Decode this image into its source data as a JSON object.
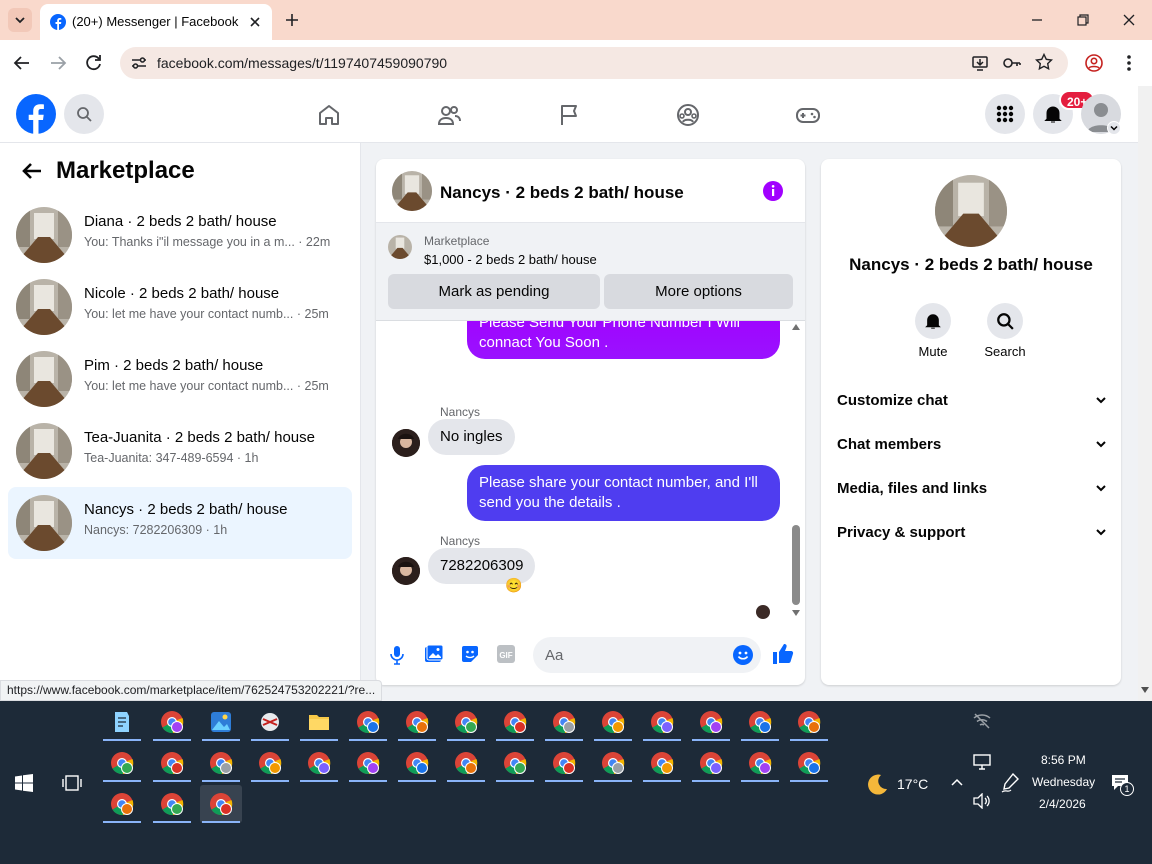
{
  "browser": {
    "tab_title": "(20+) Messenger | Facebook",
    "url": "facebook.com/messages/t/1197407459090790",
    "status_url": "https://www.facebook.com/marketplace/item/762524753202221/?re..."
  },
  "fb": {
    "notification_badge": "20+",
    "nav_icons": [
      "home-icon",
      "friends-icon",
      "pages-flag-icon",
      "groups-icon",
      "gaming-icon"
    ]
  },
  "sidebar": {
    "title": "Marketplace",
    "conversations": [
      {
        "name": "Diana · 2 beds 2 bath/ house",
        "preview": "You: Thanks i\"il message you in a m...",
        "time": "· 22m"
      },
      {
        "name": "Nicole · 2 beds 2 bath/ house",
        "preview": "You: let me have your contact numb...",
        "time": "· 25m"
      },
      {
        "name": "Pim · 2 beds 2 bath/ house",
        "preview": "You: let me have your contact numb...",
        "time": "· 25m"
      },
      {
        "name": "Tea-Juanita · 2 beds 2 bath/ house",
        "preview": "Tea-Juanita: 347-489-6594",
        "time": "· 1h"
      },
      {
        "name": "Nancys · 2 beds 2 bath/ house",
        "preview": "Nancys: 7282206309",
        "time": "· 1h"
      }
    ]
  },
  "chat": {
    "header_name": "Nancys · 2 beds 2 bath/ house",
    "marketplace_label": "Marketplace",
    "listing": "$1,000 - 2 beds 2 bath/ house",
    "mark_pending": "Mark as pending",
    "more_options": "More options",
    "messages": [
      {
        "from": "me",
        "text": "Please Send Your Phone Number I Will connact You Soon ."
      },
      {
        "from": "Nancys",
        "sender": "Nancys",
        "text": "No ingles"
      },
      {
        "from": "me",
        "text": "Please share your contact number, and I'll send you the details ."
      },
      {
        "from": "Nancys",
        "sender": "Nancys",
        "text": "7282206309",
        "reaction": "😊"
      }
    ],
    "composer_placeholder": "Aa"
  },
  "info_panel": {
    "name": "Nancys · 2 beds 2 bath/ house",
    "actions": [
      {
        "label": "Mute"
      },
      {
        "label": "Search"
      }
    ],
    "sections": [
      "Customize chat",
      "Chat members",
      "Media, files and links",
      "Privacy & support"
    ]
  },
  "taskbar": {
    "weather": "17°C",
    "time": "8:56 PM",
    "day": "Wednesday",
    "date": "2/4/2026",
    "notification_count": "1"
  },
  "colors": {
    "accent": "#0866ff",
    "outgoing_bubble_top": "#a100ff",
    "outgoing_bubble": "#5c3cf5",
    "badge": "#e41e3f"
  }
}
